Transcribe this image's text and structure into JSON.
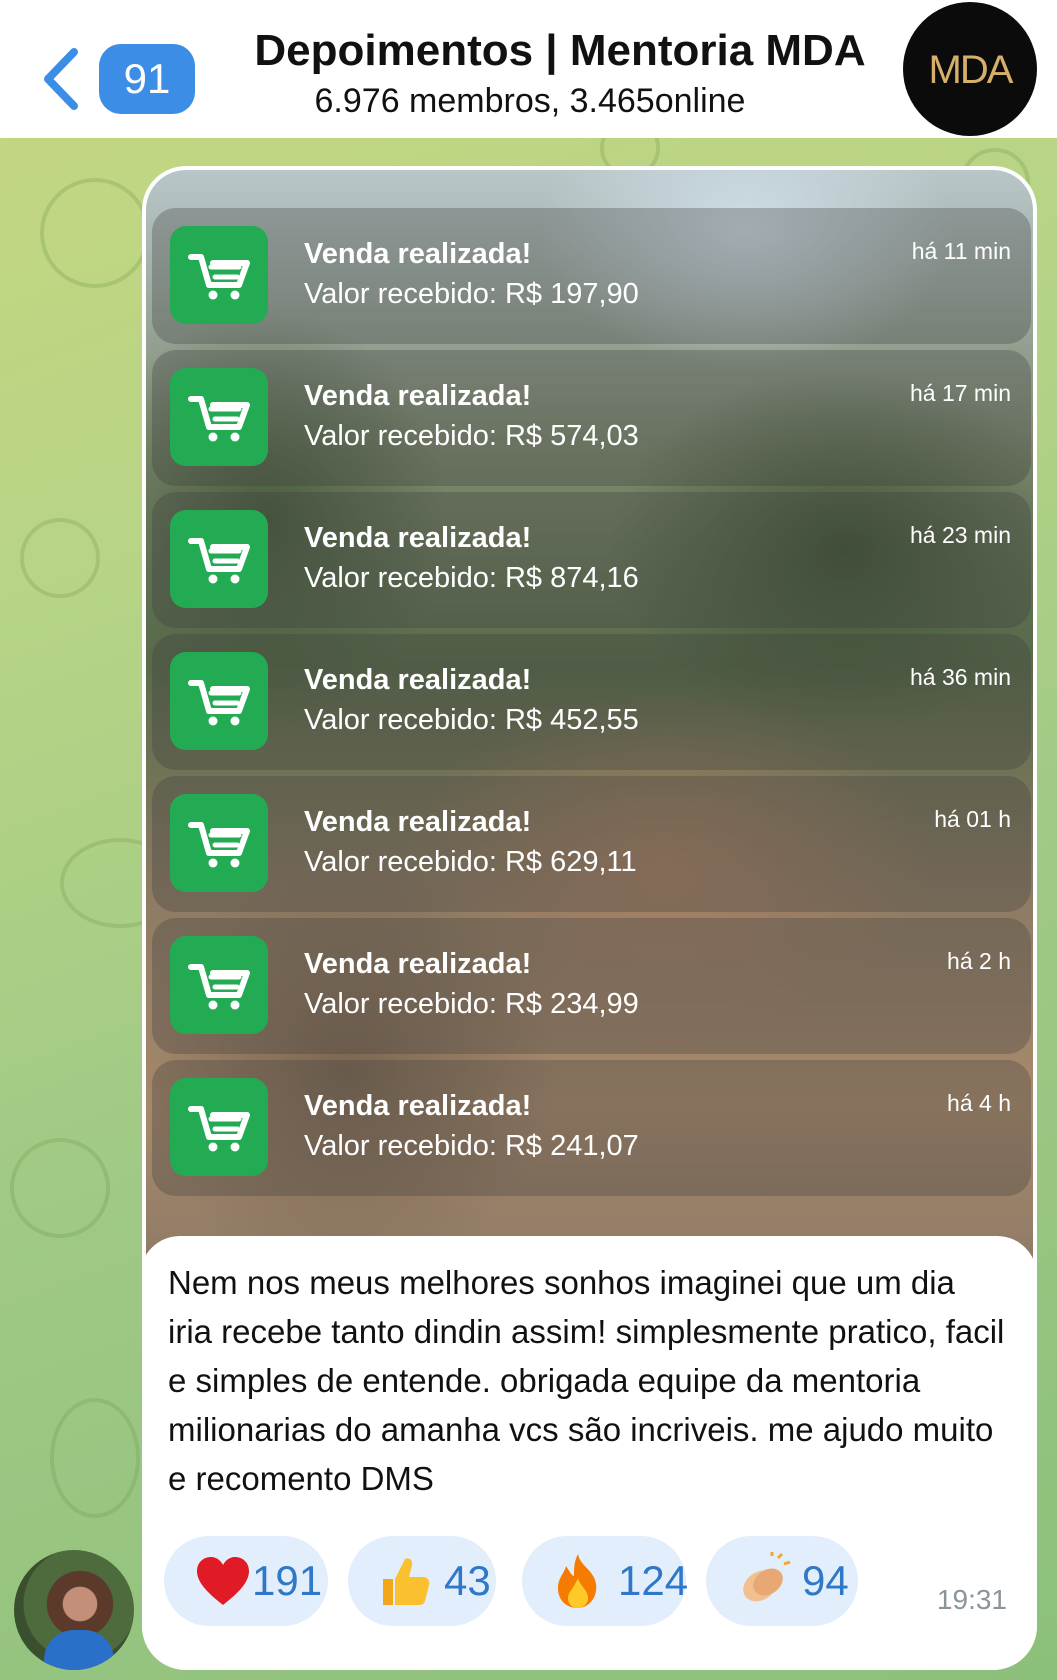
{
  "header": {
    "unread_count": "91",
    "title": "Depoimentos | Mentoria MDA",
    "subtitle": "6.976 membros, 3.465online",
    "logo_text": "MDA"
  },
  "notifications": [
    {
      "title": "Venda realizada!",
      "value": "Valor recebido: R$ 197,90",
      "time": "há 11 min"
    },
    {
      "title": "Venda realizada!",
      "value": "Valor recebido: R$ 574,03",
      "time": "há 17 min"
    },
    {
      "title": "Venda realizada!",
      "value": "Valor recebido: R$ 874,16",
      "time": "há 23 min"
    },
    {
      "title": "Venda realizada!",
      "value": "Valor recebido: R$ 452,55",
      "time": "há 36 min"
    },
    {
      "title": "Venda realizada!",
      "value": "Valor recebido: R$ 629,11",
      "time": "há 01 h"
    },
    {
      "title": "Venda realizada!",
      "value": "Valor recebido: R$ 234,99",
      "time": "há 2 h"
    },
    {
      "title": "Venda realizada!",
      "value": "Valor recebido: R$ 241,07",
      "time": "há 4 h"
    }
  ],
  "message": {
    "caption": "Nem nos meus melhores sonhos imaginei que um dia iria recebe tanto dindin assim! simplesmente pratico, facil e simples de entende. obrigada equipe da mentoria milionarias do amanha vcs são incriveis. me ajudo muito e recomento DMS",
    "time": "19:31",
    "reactions": [
      {
        "emoji": "heart-icon",
        "count": "191"
      },
      {
        "emoji": "thumbs-up-icon",
        "count": "43"
      },
      {
        "emoji": "fire-icon",
        "count": "124"
      },
      {
        "emoji": "clapping-hands-icon",
        "count": "94"
      }
    ]
  },
  "colors": {
    "accent": "#3b8de6",
    "notification_icon_bg": "#23ab54",
    "reaction_bg": "#e2eefb",
    "reaction_text": "#2f78c8"
  }
}
